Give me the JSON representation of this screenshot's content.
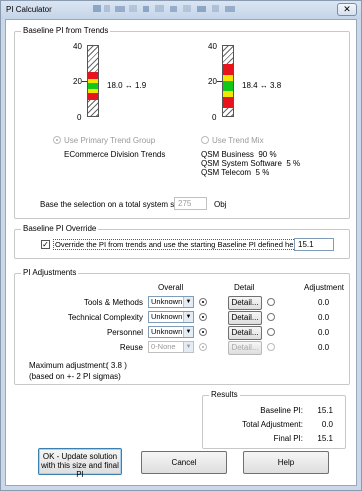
{
  "window": {
    "title": "PI Calculator",
    "close_glyph": "✕"
  },
  "baseline_trends": {
    "legend": "Baseline PI from Trends",
    "gauge_left": {
      "scale_top": "40",
      "scale_mid": "20",
      "scale_bottom": "0",
      "value": "18.0",
      "arrow": "↔",
      "sigma": "1.9",
      "level": 18.0,
      "range": [
        0,
        40
      ]
    },
    "gauge_right": {
      "scale_top": "40",
      "scale_mid": "20",
      "scale_bottom": "0",
      "value": "18.4",
      "arrow": "↔",
      "sigma": "3.8",
      "level": 18.4,
      "range": [
        0,
        40
      ]
    },
    "primary_trend_label": "Use Primary Trend Group",
    "primary_trend_name": "ECommerce Division Trends",
    "trend_mix_label": "Use Trend Mix",
    "mix": [
      {
        "name": "QSM Business",
        "pct": "90 %"
      },
      {
        "name": "QSM System Software",
        "pct": "5 %"
      },
      {
        "name": "QSM Telecom",
        "pct": "5 %"
      }
    ],
    "size_label": "Base the selection on a total system size of",
    "size_value": "275",
    "size_unit": "Obj"
  },
  "override": {
    "legend": "Baseline PI Override",
    "checkbox_glyph": "✓",
    "checkbox_label": "Override the PI from trends and use the starting Baseline PI defined here:",
    "value": "15.1"
  },
  "adjustments": {
    "legend": "PI Adjustments",
    "col_overall": "Overall",
    "col_detail": "Detail",
    "col_adjustment": "Adjustment",
    "rows": [
      {
        "label": "Tools & Methods",
        "select": "Unknown",
        "detail": "Detail...",
        "adjustment": "0.0"
      },
      {
        "label": "Technical Complexity",
        "select": "Unknown",
        "detail": "Detail...",
        "adjustment": "0.0"
      },
      {
        "label": "Personnel",
        "select": "Unknown",
        "detail": "Detail...",
        "adjustment": "0.0"
      },
      {
        "label": "Reuse",
        "select": "0-None",
        "detail": "Detail...",
        "adjustment": "0.0"
      }
    ],
    "max_label": "Maximum adjustment:",
    "max_value": "( 3.8 )",
    "max_note": "(based on +- 2 PI sigmas)"
  },
  "results": {
    "legend": "Results",
    "rows": [
      {
        "label": "Baseline PI:",
        "value": "15.1"
      },
      {
        "label": "Total Adjustment:",
        "value": "0.0"
      },
      {
        "label": "Final PI:",
        "value": "15.1"
      }
    ]
  },
  "buttons": {
    "ok": "OK - Update solution with this size and final PI",
    "cancel": "Cancel",
    "help": "Help"
  },
  "colors": {
    "red": "#e8141b",
    "yellow": "#f2e600",
    "green": "#10c81a"
  }
}
